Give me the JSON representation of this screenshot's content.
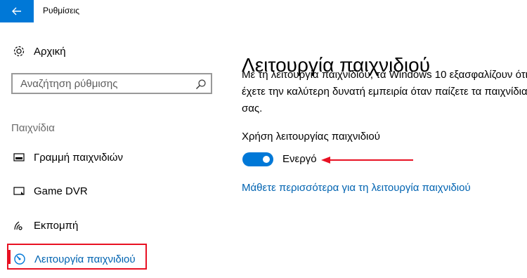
{
  "window": {
    "title": "Ρυθμίσεις",
    "accent_color": "#0078d7"
  },
  "sidebar": {
    "home_label": "Αρχική",
    "search_placeholder": "Αναζήτηση ρύθμισης",
    "section_heading": "Παιχνίδια",
    "items": [
      {
        "label": "Γραμμή παιχνιδιών",
        "icon": "game-bar-icon"
      },
      {
        "label": "Game DVR",
        "icon": "game-dvr-icon"
      },
      {
        "label": "Εκπομπή",
        "icon": "broadcast-icon"
      },
      {
        "label": "Λειτουργία παιχνιδιού",
        "icon": "game-mode-icon",
        "selected": true
      }
    ],
    "highlight_color": "#e81123"
  },
  "main": {
    "title": "Λειτουργία παιχνιδιού",
    "description_lines": [
      "Με τη λειτουργία παιχνιδιού, τα Windows 10 εξασφαλίζουν ότι",
      "έχετε την καλύτερη δυνατή εμπειρία όταν παίζετε τα παιχνίδια",
      "σας."
    ],
    "setting_label": "Χρήση λειτουργίας παιχνιδιού",
    "toggle_state": "Ενεργό",
    "toggle_on": true,
    "learn_more_link": "Μάθετε περισσότερα για τη λειτουργία παιχνιδιού",
    "link_color": "#0063b1",
    "annotation_arrow_color": "#e81123"
  }
}
